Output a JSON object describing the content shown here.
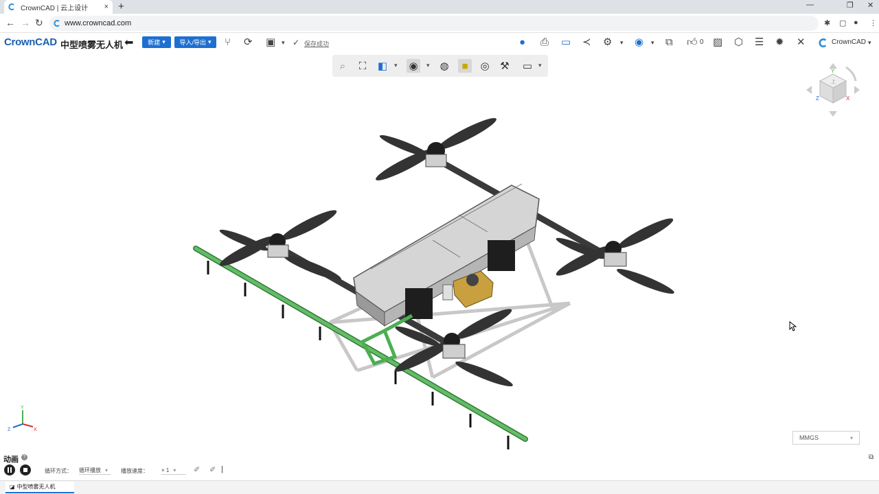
{
  "browser": {
    "tab_title": "CrownCAD | 云上设计",
    "new_tab": "+",
    "tab_close": "×",
    "url": "www.crowncad.com",
    "window_controls": [
      "—",
      "❐",
      "✕"
    ]
  },
  "app": {
    "logo": "CrownCAD",
    "doc_title": "中型喷雾无人机",
    "new_label": "新建",
    "import_export_label": "导入/导出",
    "save_status": "保存成功",
    "likes": "0",
    "brand_right": "CrownCAD"
  },
  "viewcube": {
    "top": "上",
    "y": "Y",
    "z": "Z",
    "x": "X"
  },
  "triad": {
    "x": "X",
    "y": "Y",
    "z": "Z"
  },
  "units": {
    "value": "MMGS"
  },
  "animation": {
    "title": "动画",
    "loop_label": "循环方式：",
    "loop_value": "循环播放",
    "speed_label": "播放速度：",
    "speed_value": "× 1"
  },
  "doc_tab": {
    "label": "中型喷雾无人机"
  },
  "colors": {
    "accent": "#1f6fd1",
    "boom": "#4caf50",
    "arm": "#3a3a3a",
    "tank": "#cfcfcf",
    "pump": "#c9a040"
  }
}
